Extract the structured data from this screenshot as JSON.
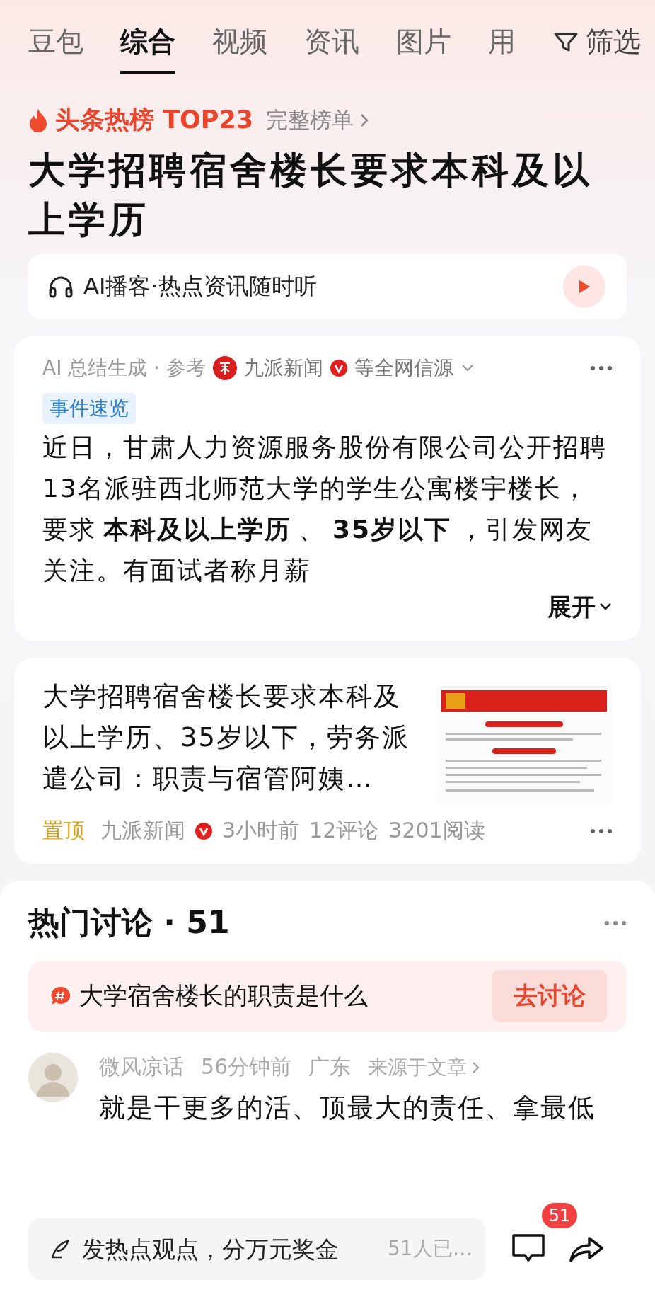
{
  "tabs": [
    {
      "label": "豆包",
      "selected": false
    },
    {
      "label": "综合",
      "selected": true
    },
    {
      "label": "视频",
      "selected": false
    },
    {
      "label": "资讯",
      "selected": false
    },
    {
      "label": "图片",
      "selected": false
    },
    {
      "label": "用",
      "selected": false
    }
  ],
  "filter": {
    "label": "筛选"
  },
  "hot_list": {
    "rank_label": "头条热榜 TOP23",
    "full_list_link": "完整榜单"
  },
  "headline": "大学招聘宿舍楼长要求本科及以上学历",
  "podcast": {
    "label": "AI播客·热点资讯随时听"
  },
  "summary": {
    "source_note": "AI 总结生成 · 参考",
    "source_name": "九派新闻",
    "verified": true,
    "more_sources": "等全网信源",
    "tag": "事件速览",
    "text": "近日，甘肃人力资源服务股份有限公司公开招聘13名派驻西北师范大学的学生公寓楼宇楼长，要求**本科及以上学历**、**35岁以下**，引发网友关注。有面试者称月薪",
    "expand": "展开"
  },
  "article": {
    "title": "大学招聘宿舍楼长要求本科及以上学历、35岁以下，劳务派遣公司：职责与宿管阿姨…",
    "pinned_label": "置顶",
    "source": "九派新闻",
    "verified": true,
    "time": "3小时前",
    "comments": "12评论",
    "reads": "3201阅读"
  },
  "discussion": {
    "title": "热门讨论 · 51",
    "topic": {
      "text": "大学宿舍楼长的职责是什么",
      "button": "去讨论"
    },
    "comments": [
      {
        "user": "微风凉话",
        "time": "56分钟前",
        "location": "广东",
        "source_link": "来源于文章",
        "text": "就是干更多的活、顶最大的责任、拿最低"
      }
    ]
  },
  "bottom_bar": {
    "placeholder": "发热点观点，分万元奖金",
    "participants": "51人已…",
    "comment_badge": "51"
  }
}
